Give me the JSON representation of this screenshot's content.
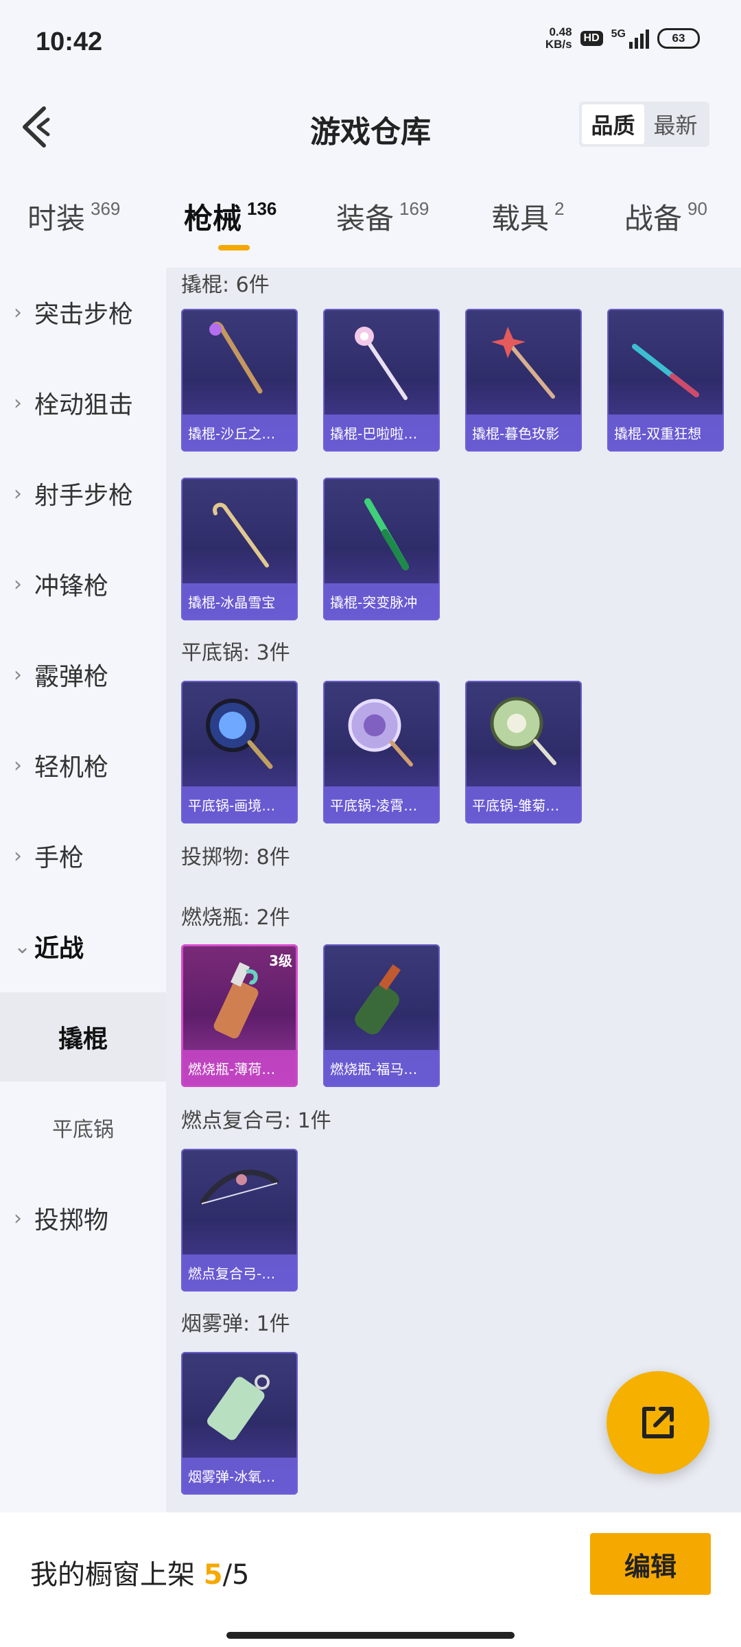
{
  "status_bar": {
    "time": "10:42",
    "net_speed_value": "0.48",
    "net_speed_unit": "KB/s",
    "hd": "HD",
    "network": "5G",
    "battery": "63"
  },
  "header": {
    "title": "游戏仓库",
    "sort_options": [
      "品质",
      "最新"
    ],
    "sort_selected": "品质"
  },
  "tabs": [
    {
      "label": "时装",
      "count": "369"
    },
    {
      "label": "枪械",
      "count": "136",
      "active": true
    },
    {
      "label": "装备",
      "count": "169"
    },
    {
      "label": "载具",
      "count": "2"
    },
    {
      "label": "战备",
      "count": "90"
    }
  ],
  "sidebar": [
    {
      "label": "突击步枪",
      "chevron": "›"
    },
    {
      "label": "栓动狙击",
      "chevron": "›"
    },
    {
      "label": "射手步枪",
      "chevron": "›"
    },
    {
      "label": "冲锋枪",
      "chevron": "›"
    },
    {
      "label": "霰弹枪",
      "chevron": "›"
    },
    {
      "label": "轻机枪",
      "chevron": "›"
    },
    {
      "label": "手枪",
      "chevron": "›"
    },
    {
      "label": "近战",
      "chevron": "⌄",
      "expanded": true
    },
    {
      "label": "撬棍",
      "sub": true,
      "active": true
    },
    {
      "label": "平底锅",
      "sub": true
    },
    {
      "label": "投掷物",
      "chevron": "›"
    }
  ],
  "sections": {
    "crowbar": "撬棍: 6件",
    "pan": "平底锅: 3件",
    "throwables": "投掷物: 8件",
    "molotov": "燃烧瓶: 2件",
    "bow": "燃点复合弓: 1件",
    "smoke": "烟雾弹: 1件"
  },
  "items": {
    "crowbar": [
      "撬棍-沙丘之…",
      "撬棍-巴啦啦…",
      "撬棍-暮色玫影",
      "撬棍-双重狂想",
      "撬棍-冰晶雪宝",
      "撬棍-突变脉冲"
    ],
    "pan": [
      "平底锅-画境…",
      "平底锅-凌霄…",
      "平底锅-雏菊…"
    ],
    "molotov": [
      "燃烧瓶-薄荷…",
      "燃烧瓶-福马…"
    ],
    "molotov_level": "3级",
    "bow": [
      "燃点复合弓-…"
    ],
    "smoke": [
      "烟雾弹-冰氧…"
    ]
  },
  "footer": {
    "label": "我的橱窗上架 ",
    "used": "5",
    "sep": "/",
    "total": "5",
    "edit_label": "编辑"
  },
  "colors": {
    "accent": "#f5a800",
    "card_purple": "#3b3a78",
    "card_pink": "#d64bd0"
  },
  "icons": {
    "back": "back-arrow-icon",
    "fab": "share-external-icon"
  }
}
